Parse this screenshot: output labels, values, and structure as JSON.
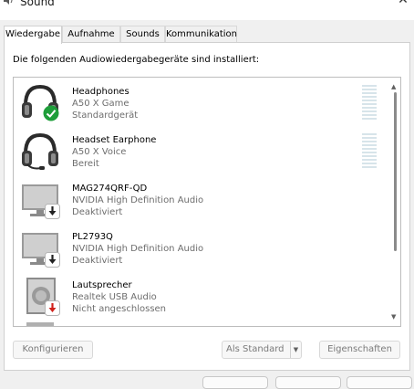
{
  "window": {
    "title": "Sound",
    "close_icon": "close-icon"
  },
  "tabs": [
    {
      "label": "Wiedergabe",
      "active": true
    },
    {
      "label": "Aufnahme",
      "active": false
    },
    {
      "label": "Sounds",
      "active": false
    },
    {
      "label": "Kommunikation",
      "active": false
    }
  ],
  "playback": {
    "intro": "Die folgenden Audiowiedergabegeräte sind installiert:",
    "devices": [
      {
        "name": "Headphones",
        "description": "A50 X Game",
        "status": "Standardgerät",
        "icon": "headset-icon",
        "badge": "default-check-icon"
      },
      {
        "name": "Headset Earphone",
        "description": "A50 X Voice",
        "status": "Bereit",
        "icon": "headset-mic-icon",
        "badge": ""
      },
      {
        "name": "MAG274QRF-QD",
        "description": "NVIDIA High Definition Audio",
        "status": "Deaktiviert",
        "icon": "monitor-icon",
        "badge": "disabled-arrow-icon"
      },
      {
        "name": "PL2793Q",
        "description": "NVIDIA High Definition Audio",
        "status": "Deaktiviert",
        "icon": "monitor-icon",
        "badge": "disabled-arrow-icon"
      },
      {
        "name": "Lautsprecher",
        "description": "Realtek USB Audio",
        "status": "Nicht angeschlossen",
        "icon": "speaker-icon",
        "badge": "unplugged-arrow-icon"
      }
    ]
  },
  "buttons": {
    "configure": "Konfigurieren",
    "set_default": "Als Standard",
    "properties": "Eigenschaften"
  },
  "colors": {
    "check_badge": "#1e9e3a",
    "unplugged_badge": "#d0201a",
    "meter": "#d7e4ea"
  }
}
